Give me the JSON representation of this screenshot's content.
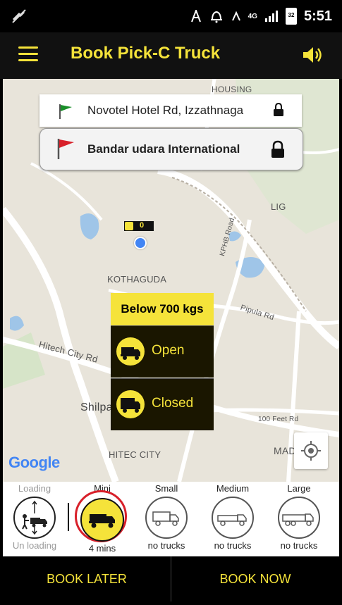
{
  "status_bar": {
    "time": "5:51",
    "network": "4G",
    "battery": "32"
  },
  "app_bar": {
    "title": "Book Pick-C Truck"
  },
  "map": {
    "labels": {
      "housing": "HOUSING",
      "lig": "LIG",
      "kothaguda": "KOTHAGUDA",
      "kphb_road": "KPHB Road",
      "pipula_rd": "Pipula Rd",
      "hitech_city_rd": "Hitech City Rd",
      "shilpa": "Shilpa",
      "feet_rd": "100 Feet Rd",
      "madhap": "MADHAP",
      "hitec_city": "HITEC CITY",
      "google": "Google"
    },
    "pickup": "Novotel Hotel Rd, Izzathnaga",
    "drop": "Bandar udara International",
    "marker_label": "0"
  },
  "weight_popup": {
    "header": "Below 700 kgs",
    "options": [
      "Open",
      "Closed"
    ]
  },
  "truck_types": [
    {
      "name": "Loading",
      "sub": "Un loading"
    },
    {
      "name": "Mini",
      "sub": "4 mins",
      "selected": true
    },
    {
      "name": "Small",
      "sub": "no trucks"
    },
    {
      "name": "Medium",
      "sub": "no trucks"
    },
    {
      "name": "Large",
      "sub": "no trucks"
    }
  ],
  "actions": {
    "book_later": "BOOK LATER",
    "book_now": "BOOK NOW"
  },
  "colors": {
    "accent": "#f5e33a",
    "dark": "#111111",
    "selected_ring": "#d8202a"
  }
}
